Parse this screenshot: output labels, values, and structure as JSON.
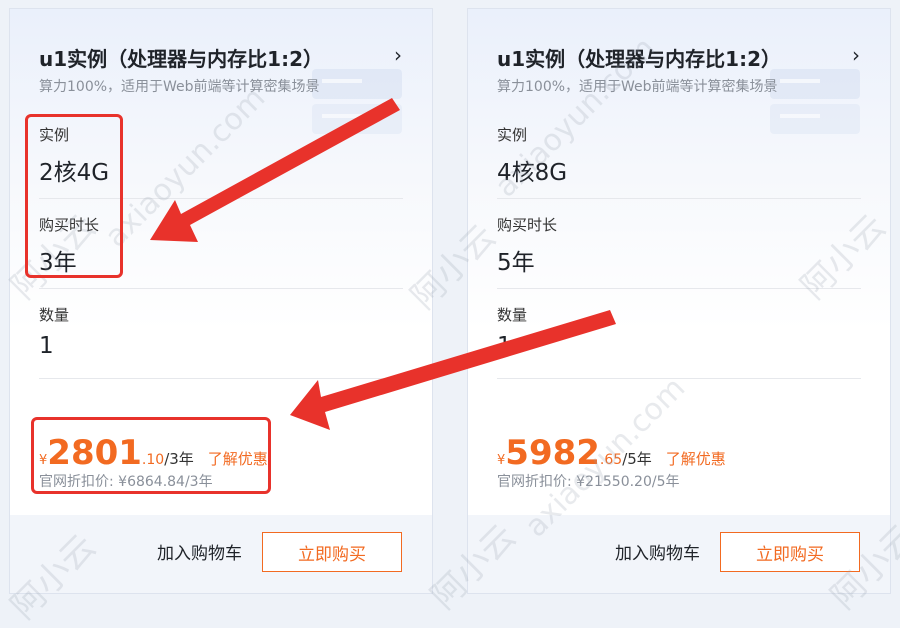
{
  "watermark": {
    "brand_cn": "阿小云",
    "brand_en": "axiaoyun.com"
  },
  "cards": [
    {
      "title": "u1实例（处理器与内存比1:2）",
      "chevron": "›",
      "subtitle": "算力100%，适用于Web前端等计算密集场景",
      "instance_label": "实例",
      "instance_value": "2核4G",
      "duration_label": "购买时长",
      "duration_value": "3年",
      "quantity_label": "数量",
      "quantity_value": "1",
      "currency": "¥",
      "price_int": "2801",
      "price_dec": ".10",
      "price_unit": "/3年",
      "promo_link": "了解优惠",
      "official_price": "官网折扣价: ¥6864.84/3年",
      "cart_button": "加入购物车",
      "buy_button": "立即购买"
    },
    {
      "title": "u1实例（处理器与内存比1:2）",
      "chevron": "›",
      "subtitle": "算力100%，适用于Web前端等计算密集场景",
      "instance_label": "实例",
      "instance_value": "4核8G",
      "duration_label": "购买时长",
      "duration_value": "5年",
      "quantity_label": "数量",
      "quantity_value": "1",
      "currency": "¥",
      "price_int": "5982",
      "price_dec": ".65",
      "price_unit": "/5年",
      "promo_link": "了解优惠",
      "official_price": "官网折扣价: ¥21550.20/5年",
      "cart_button": "加入购物车",
      "buy_button": "立即购买"
    }
  ],
  "annotation_color": "#e8322b",
  "accent_color": "#f26a21"
}
